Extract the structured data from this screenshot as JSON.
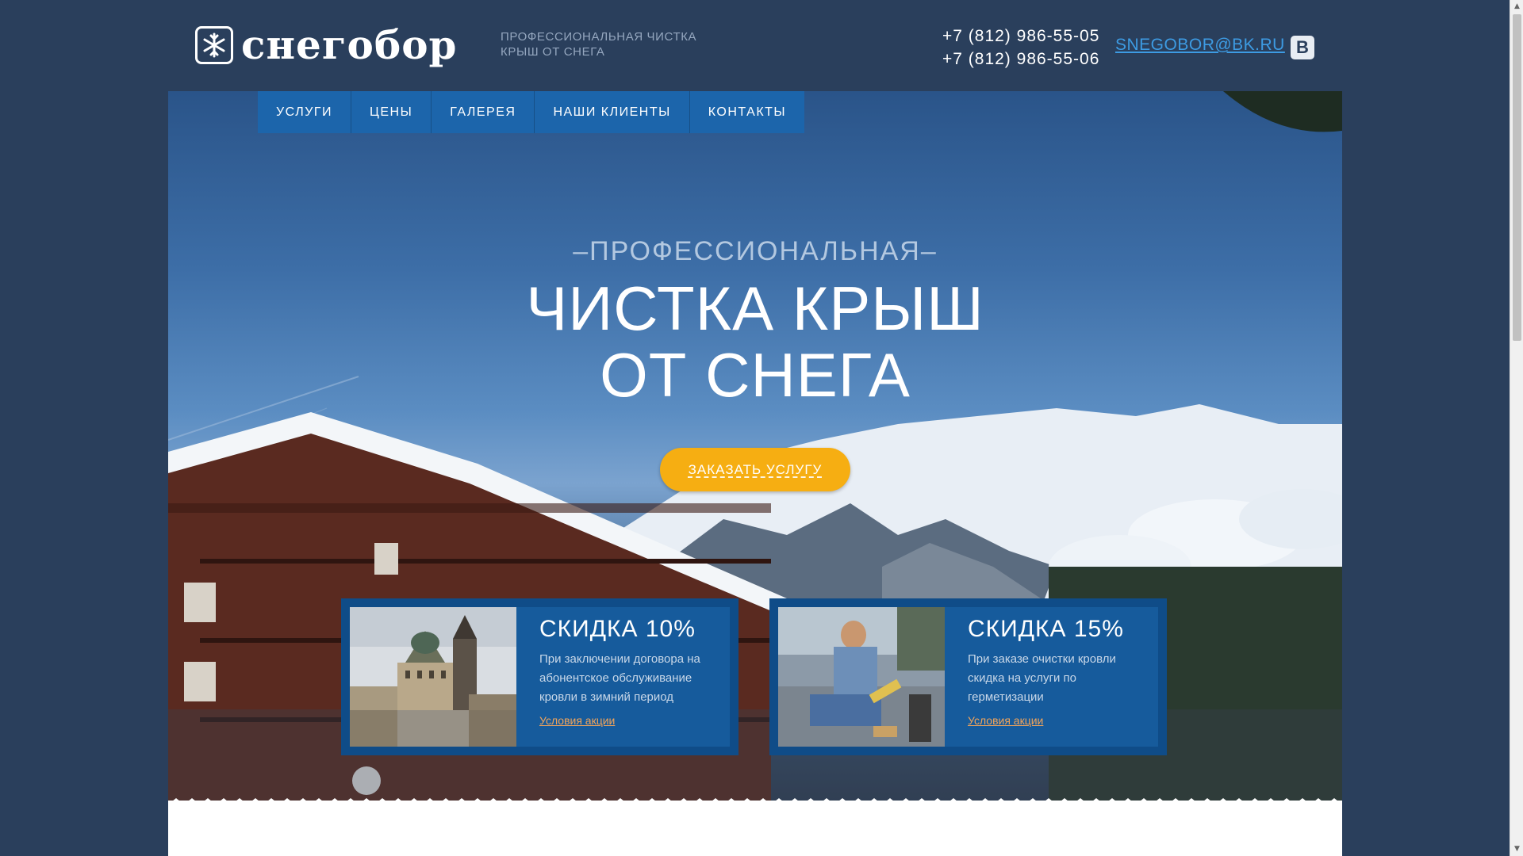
{
  "brand": {
    "name": "снегобор",
    "tagline_line1": "ПРОФЕССИОНАЛЬНАЯ ЧИСТКА",
    "tagline_line2": "КРЫШ ОТ СНЕГА"
  },
  "contacts": {
    "phone1": "+7 (812) 986-55-05",
    "phone2": "+7 (812) 986-55-06",
    "email": "SNEGOBOR@BK.RU",
    "vk_label": "В"
  },
  "nav": {
    "items": [
      {
        "label": "УСЛУГИ"
      },
      {
        "label": "ЦЕНЫ"
      },
      {
        "label": "ГАЛЕРЕЯ"
      },
      {
        "label": "НАШИ КЛИЕНТЫ"
      },
      {
        "label": "КОНТАКТЫ"
      }
    ]
  },
  "hero": {
    "eyebrow": "–ПРОФЕССИОНАЛЬНАЯ–",
    "headline_line1": "ЧИСТКА КРЫШ",
    "headline_line2": "ОТ СНЕГА",
    "cta_label": "ЗАКАЗАТЬ УСЛУГУ"
  },
  "promos": [
    {
      "title": "СКИДКА 10%",
      "text": "При заключении договора на абонентское обслуживание кровли в зимний период",
      "link": "Условия акции"
    },
    {
      "title": "СКИДКА 15%",
      "text": "При заказе очистки кровли скидка на услуги по герметизации",
      "link": "Условия акции"
    }
  ],
  "colors": {
    "page_bg": "#2a3f5c",
    "nav_bg": "#1c65ab",
    "cta": "#f6ae12",
    "link_orange": "#f2a45a",
    "email_link": "#3d9be3"
  }
}
